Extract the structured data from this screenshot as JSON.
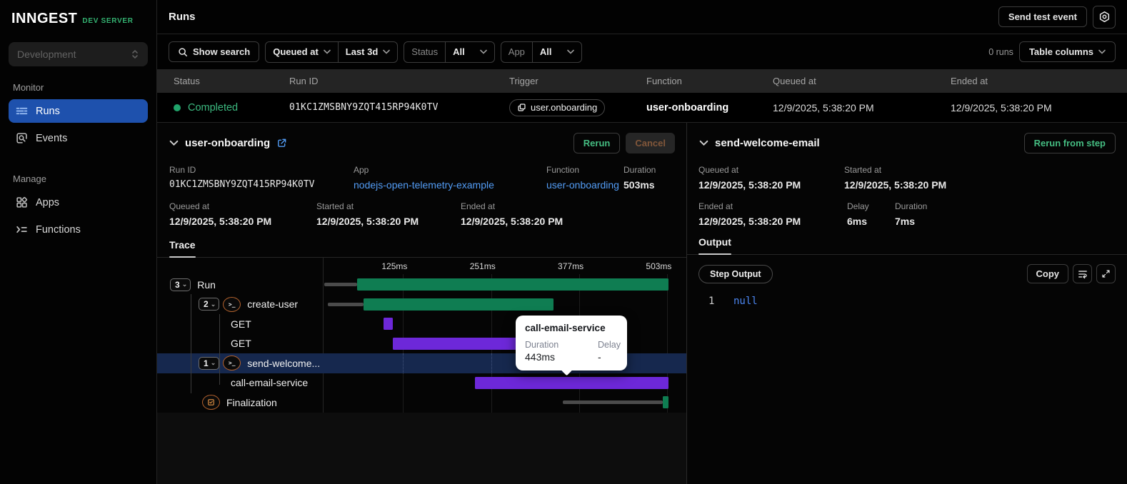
{
  "sidebar": {
    "logo": "INNGEST",
    "logo_badge": "DEV SERVER",
    "env_select": "Development",
    "sections": [
      {
        "label": "Monitor",
        "items": [
          {
            "label": "Runs",
            "active": true
          },
          {
            "label": "Events",
            "active": false
          }
        ]
      },
      {
        "label": "Manage",
        "items": [
          {
            "label": "Apps",
            "active": false
          },
          {
            "label": "Functions",
            "active": false
          }
        ]
      }
    ]
  },
  "topbar": {
    "title": "Runs",
    "send_test_event": "Send test event"
  },
  "filters": {
    "show_search": "Show search",
    "queued_at": "Queued at",
    "time_range": "Last 3d",
    "status_label": "Status",
    "status_value": "All",
    "app_label": "App",
    "app_value": "All",
    "runs_count": "0 runs",
    "table_columns": "Table columns"
  },
  "table": {
    "headers": [
      "Status",
      "Run ID",
      "Trigger",
      "Function",
      "Queued at",
      "Ended at"
    ],
    "row": {
      "status": "Completed",
      "run_id": "01KC1ZMSBNY9ZQT415RP94K0TV",
      "trigger": "user.onboarding",
      "function": "user-onboarding",
      "queued_at": "12/9/2025, 5:38:20 PM",
      "ended_at": "12/9/2025, 5:38:20 PM"
    }
  },
  "run_details": {
    "title": "user-onboarding",
    "rerun": "Rerun",
    "cancel": "Cancel",
    "run_id_label": "Run ID",
    "run_id": "01KC1ZMSBNY9ZQT415RP94K0TV",
    "app_label": "App",
    "app": "nodejs-open-telemetry-example",
    "function_label": "Function",
    "function": "user-onboarding",
    "duration_label": "Duration",
    "duration": "503ms",
    "queued_label": "Queued at",
    "queued": "12/9/2025, 5:38:20 PM",
    "started_label": "Started at",
    "started": "12/9/2025, 5:38:20 PM",
    "ended_label": "Ended at",
    "ended": "12/9/2025, 5:38:20 PM",
    "tab": "Trace"
  },
  "chart_data": {
    "type": "waterfall-trace",
    "unit": "ms",
    "xlim": [
      0,
      510
    ],
    "axis_ticks_ms": [
      125,
      251,
      377,
      503
    ],
    "axis_tick_labels": [
      "125ms",
      "251ms",
      "377ms",
      "503ms"
    ],
    "rows": [
      {
        "label": "Run",
        "collapse_count": "3",
        "indent": 18,
        "queue_ms": [
          12,
          59
        ],
        "bar_ms": [
          59,
          505
        ],
        "color": "green"
      },
      {
        "label": "create-user",
        "collapse_count": "2",
        "icon": "step-run-icon",
        "indent": 58,
        "queue_ms": [
          17,
          68
        ],
        "bar_ms": [
          68,
          340
        ],
        "color": "green"
      },
      {
        "label": "GET",
        "indent": 103,
        "bar_ms": [
          97,
          110
        ],
        "color": "purple"
      },
      {
        "label": "GET",
        "indent": 103,
        "bar_ms": [
          110,
          291
        ],
        "color": "purple"
      },
      {
        "label": "send-welcome...",
        "collapse_count": "1",
        "icon": "step-run-icon",
        "indent": 58,
        "bar_ms": [
          345,
          366
        ],
        "color": "green",
        "highlighted": true
      },
      {
        "label": "call-email-service",
        "indent": 103,
        "bar_ms": [
          228,
          505
        ],
        "color": "purple"
      },
      {
        "label": "Finalization",
        "icon": "finalization-icon",
        "indent": 63,
        "queue_ms": [
          353,
          496
        ],
        "bar_ms": [
          496,
          505
        ],
        "color": "green"
      }
    ]
  },
  "tooltip": {
    "title": "call-email-service",
    "duration_label": "Duration",
    "delay_label": "Delay",
    "duration": "443ms",
    "delay": "-"
  },
  "step_details": {
    "title": "send-welcome-email",
    "rerun_from_step": "Rerun from step",
    "queued_label": "Queued at",
    "queued": "12/9/2025, 5:38:20 PM",
    "started_label": "Started at",
    "started": "12/9/2025, 5:38:20 PM",
    "ended_label": "Ended at",
    "ended": "12/9/2025, 5:38:20 PM",
    "delay_label": "Delay",
    "delay": "6ms",
    "duration_label": "Duration",
    "duration": "7ms",
    "tab": "Output",
    "output_badge": "Step Output",
    "copy": "Copy",
    "code": {
      "line": "1",
      "value": "null"
    }
  },
  "colors": {
    "bar_green": "#0f7d52",
    "bar_purple": "#6d28d9",
    "status_green": "#3cba80",
    "link_blue": "#539df6",
    "active_nav_blue": "#1e51ad",
    "highlight_row_navy": "#16284e",
    "dev_server_green": "#34b271",
    "null_blue": "#4c87f3",
    "step_icon_orange": "#b4622d"
  }
}
